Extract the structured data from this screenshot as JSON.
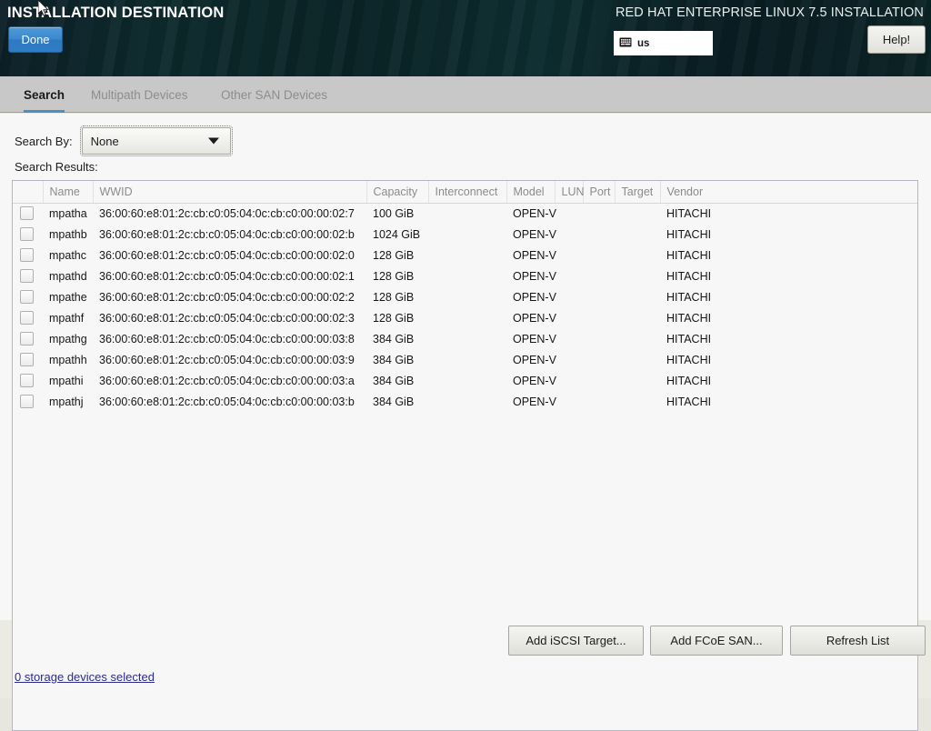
{
  "header": {
    "title": "INSTALLATION DESTINATION",
    "product": "RED HAT ENTERPRISE LINUX 7.5 INSTALLATION",
    "done_label": "Done",
    "help_label": "Help!",
    "keyboard_layout": "us",
    "keyboard_icon": "keyboard-icon",
    "bg_color": "#0b2327",
    "accent_color": "#3d88cd"
  },
  "tabs": [
    {
      "label": "Search",
      "active": true
    },
    {
      "label": "Multipath Devices",
      "active": false
    },
    {
      "label": "Other SAN Devices",
      "active": false
    }
  ],
  "search": {
    "search_by_label": "Search By:",
    "search_by_value": "None",
    "search_by_options": [
      "None"
    ],
    "results_label": "Search Results:"
  },
  "table": {
    "columns": [
      {
        "key": "check",
        "label": ""
      },
      {
        "key": "name",
        "label": "Name"
      },
      {
        "key": "wwid",
        "label": "WWID"
      },
      {
        "key": "capacity",
        "label": "Capacity"
      },
      {
        "key": "interconnect",
        "label": "Interconnect"
      },
      {
        "key": "model",
        "label": "Model"
      },
      {
        "key": "lun",
        "label": "LUN"
      },
      {
        "key": "port",
        "label": "Port"
      },
      {
        "key": "target",
        "label": "Target"
      },
      {
        "key": "vendor",
        "label": "Vendor"
      }
    ],
    "rows": [
      {
        "checked": false,
        "name": "mpatha",
        "wwid": "36:00:60:e8:01:2c:cb:c0:05:04:0c:cb:c0:00:00:02:7",
        "capacity": "100 GiB",
        "interconnect": "",
        "model": "OPEN-V",
        "lun": "",
        "port": "",
        "target": "",
        "vendor": "HITACHI"
      },
      {
        "checked": false,
        "name": "mpathb",
        "wwid": "36:00:60:e8:01:2c:cb:c0:05:04:0c:cb:c0:00:00:02:b",
        "capacity": "1024 GiB",
        "interconnect": "",
        "model": "OPEN-V",
        "lun": "",
        "port": "",
        "target": "",
        "vendor": "HITACHI"
      },
      {
        "checked": false,
        "name": "mpathc",
        "wwid": "36:00:60:e8:01:2c:cb:c0:05:04:0c:cb:c0:00:00:02:0",
        "capacity": "128 GiB",
        "interconnect": "",
        "model": "OPEN-V",
        "lun": "",
        "port": "",
        "target": "",
        "vendor": "HITACHI"
      },
      {
        "checked": false,
        "name": "mpathd",
        "wwid": "36:00:60:e8:01:2c:cb:c0:05:04:0c:cb:c0:00:00:02:1",
        "capacity": "128 GiB",
        "interconnect": "",
        "model": "OPEN-V",
        "lun": "",
        "port": "",
        "target": "",
        "vendor": "HITACHI"
      },
      {
        "checked": false,
        "name": "mpathe",
        "wwid": "36:00:60:e8:01:2c:cb:c0:05:04:0c:cb:c0:00:00:02:2",
        "capacity": "128 GiB",
        "interconnect": "",
        "model": "OPEN-V",
        "lun": "",
        "port": "",
        "target": "",
        "vendor": "HITACHI"
      },
      {
        "checked": false,
        "name": "mpathf",
        "wwid": "36:00:60:e8:01:2c:cb:c0:05:04:0c:cb:c0:00:00:02:3",
        "capacity": "128 GiB",
        "interconnect": "",
        "model": "OPEN-V",
        "lun": "",
        "port": "",
        "target": "",
        "vendor": "HITACHI"
      },
      {
        "checked": false,
        "name": "mpathg",
        "wwid": "36:00:60:e8:01:2c:cb:c0:05:04:0c:cb:c0:00:00:03:8",
        "capacity": "384 GiB",
        "interconnect": "",
        "model": "OPEN-V",
        "lun": "",
        "port": "",
        "target": "",
        "vendor": "HITACHI"
      },
      {
        "checked": false,
        "name": "mpathh",
        "wwid": "36:00:60:e8:01:2c:cb:c0:05:04:0c:cb:c0:00:00:03:9",
        "capacity": "384 GiB",
        "interconnect": "",
        "model": "OPEN-V",
        "lun": "",
        "port": "",
        "target": "",
        "vendor": "HITACHI"
      },
      {
        "checked": false,
        "name": "mpathi",
        "wwid": "36:00:60:e8:01:2c:cb:c0:05:04:0c:cb:c0:00:00:03:a",
        "capacity": "384 GiB",
        "interconnect": "",
        "model": "OPEN-V",
        "lun": "",
        "port": "",
        "target": "",
        "vendor": "HITACHI"
      },
      {
        "checked": false,
        "name": "mpathj",
        "wwid": "36:00:60:e8:01:2c:cb:c0:05:04:0c:cb:c0:00:00:03:b",
        "capacity": "384 GiB",
        "interconnect": "",
        "model": "OPEN-V",
        "lun": "",
        "port": "",
        "target": "",
        "vendor": "HITACHI"
      }
    ]
  },
  "footer": {
    "add_iscsi_label": "Add iSCSI Target...",
    "add_fcoe_label": "Add FCoE SAN...",
    "refresh_label": "Refresh List",
    "storage_status": "0 storage devices selected",
    "storage_status_color": "#2b2b8f"
  }
}
